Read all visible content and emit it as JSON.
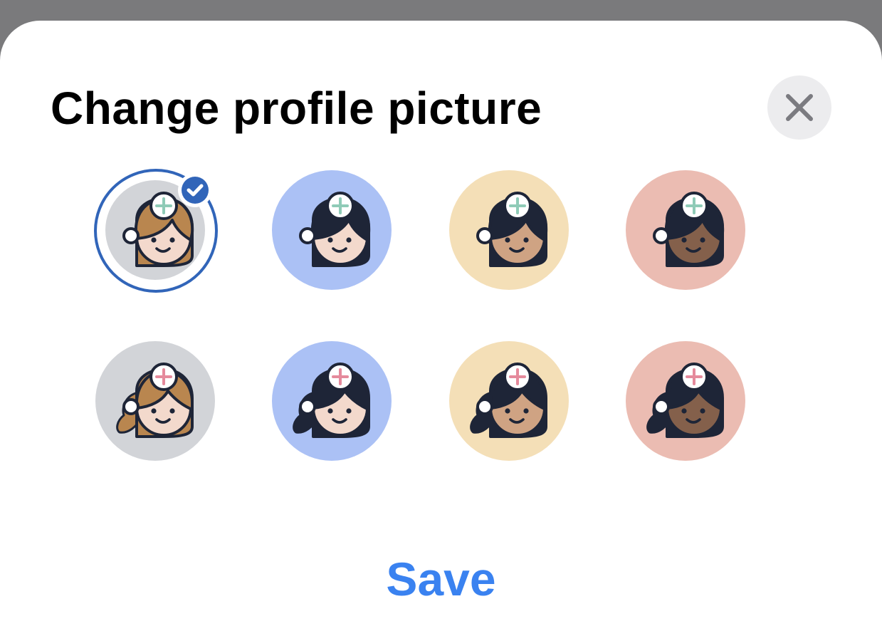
{
  "dialog": {
    "title": "Change profile picture",
    "close_icon": "close-icon",
    "save_label": "Save"
  },
  "avatars": [
    {
      "id": "nurse-1",
      "style": "short-hair",
      "background": "#d2d4d8",
      "skin": "#f3d9cc",
      "hair": "#b9864f",
      "cross": "#8fcbb7",
      "selected": true
    },
    {
      "id": "nurse-2",
      "style": "short-hair",
      "background": "#abc1f5",
      "skin": "#f3d9cc",
      "hair": "#1e2537",
      "cross": "#8fcbb7",
      "selected": false
    },
    {
      "id": "nurse-3",
      "style": "short-hair",
      "background": "#f4dfb7",
      "skin": "#cfa383",
      "hair": "#1e2537",
      "cross": "#8fcbb7",
      "selected": false
    },
    {
      "id": "nurse-4",
      "style": "short-hair",
      "background": "#ebbcb2",
      "skin": "#84604b",
      "hair": "#1e2537",
      "cross": "#8fcbb7",
      "selected": false
    },
    {
      "id": "nurse-5",
      "style": "ponytail",
      "background": "#d2d4d8",
      "skin": "#f3d9cc",
      "hair": "#b9864f",
      "cross": "#e58a9c",
      "selected": false
    },
    {
      "id": "nurse-6",
      "style": "ponytail",
      "background": "#abc1f5",
      "skin": "#f3d9cc",
      "hair": "#1e2537",
      "cross": "#e58a9c",
      "selected": false
    },
    {
      "id": "nurse-7",
      "style": "ponytail",
      "background": "#f4dfb7",
      "skin": "#cfa383",
      "hair": "#1e2537",
      "cross": "#e58a9c",
      "selected": false
    },
    {
      "id": "nurse-8",
      "style": "ponytail",
      "background": "#ebbcb2",
      "skin": "#84604b",
      "hair": "#1e2537",
      "cross": "#e58a9c",
      "selected": false
    }
  ],
  "colors": {
    "selection_ring": "#3165b9",
    "save_text": "#3a82f0",
    "outline": "#1e2537"
  }
}
